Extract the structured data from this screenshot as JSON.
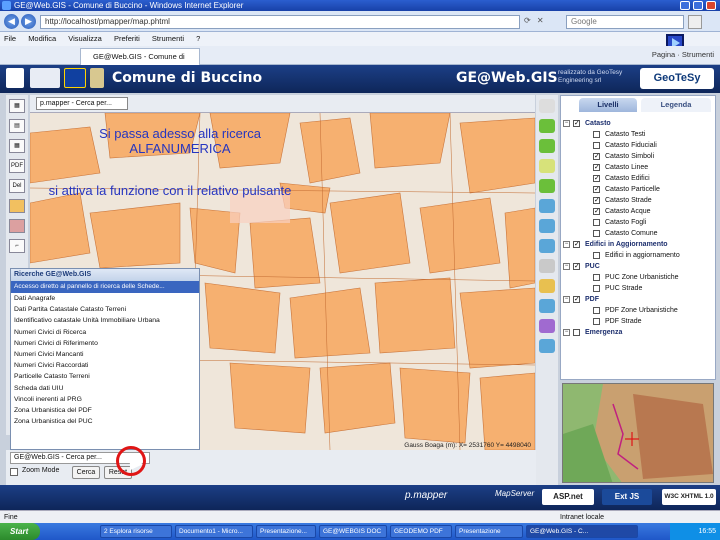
{
  "browser": {
    "title": "GE@Web.GIS - Comune di Buccino - Windows Internet Explorer",
    "url": "http://localhost/pmapper/map.phtml",
    "search_placeholder": "Google",
    "menu": [
      "File",
      "Modifica",
      "Visualizza",
      "Preferiti",
      "Strumenti",
      "?"
    ],
    "tab_label": "GE@Web.GIS - Comune di Buccino",
    "tools": [
      "Pagina",
      "Strumenti"
    ]
  },
  "app": {
    "title": "Comune di Buccino",
    "brand": "GE@Web.GIS",
    "subtitle": "realizzato da GeoTesy Engineering srl",
    "partner": "GeoTeSy",
    "map_select": "p.mapper - Cerca per..."
  },
  "overlay": {
    "note1": "Si passa adesso alla ricerca ALFANUMERICA",
    "note2": "si attiva la funzione con il relativo pulsante"
  },
  "search_panel": {
    "title": "Ricerche GE@Web.GIS",
    "selected": "Accesso diretto al pannello di ricerca delle Schede...",
    "items": [
      "Dati Anagrafe",
      "Dati Partita Catastale Catasto Terreni",
      "Identificativo catastale Unità Immobiliare Urbana",
      "Numeri Civici di Ricerca",
      "Numeri Civici di Riferimento",
      "Numeri Civici Mancanti",
      "Numeri Civici Raccordati",
      "Particelle Catasto Terreni",
      "Scheda dati UIU",
      "Vincoli inerenti al PRG",
      "Zona Urbanistica del PDF",
      "Zona Urbanistica del PUC"
    ]
  },
  "bottom_search": {
    "field": "GE@Web.GIS - Cerca per...",
    "zoom_mode": "Zoom Mode",
    "search_btn": "Cerca",
    "reset_btn": "Reset"
  },
  "map": {
    "scale_text": "Gauss Boaga (m): X= 2531760 Y= 4498040"
  },
  "layers": {
    "tab_livelli": "Livelli",
    "tab_legenda": "Legenda",
    "rows": [
      {
        "label": "Catasto",
        "type": "group",
        "checked": true
      },
      {
        "label": "Catasto Testi",
        "type": "item",
        "checked": false
      },
      {
        "label": "Catasto Fiduciali",
        "type": "item",
        "checked": false
      },
      {
        "label": "Catasto Simboli",
        "type": "item",
        "checked": true
      },
      {
        "label": "Catasto Linee",
        "type": "item",
        "checked": true
      },
      {
        "label": "Catasto Edifici",
        "type": "item",
        "checked": true
      },
      {
        "label": "Catasto Particelle",
        "type": "item",
        "checked": true
      },
      {
        "label": "Catasto Strade",
        "type": "item",
        "checked": true
      },
      {
        "label": "Catasto Acque",
        "type": "item",
        "checked": true
      },
      {
        "label": "Catasto Fogli",
        "type": "item",
        "checked": false
      },
      {
        "label": "Catasto Comune",
        "type": "item",
        "checked": false
      },
      {
        "label": "Edifici in Aggiornamento",
        "type": "group",
        "checked": true
      },
      {
        "label": "Edifici in aggiornamento",
        "type": "item",
        "checked": false
      },
      {
        "label": "PUC",
        "type": "group",
        "checked": true
      },
      {
        "label": "PUC Zone Urbanistiche",
        "type": "item",
        "checked": false
      },
      {
        "label": "PUC Strade",
        "type": "item",
        "checked": false
      },
      {
        "label": "PDF",
        "type": "group",
        "checked": true
      },
      {
        "label": "PDF Zone Urbanistiche",
        "type": "item",
        "checked": false
      },
      {
        "label": "PDF Strade",
        "type": "item",
        "checked": false
      },
      {
        "label": "Emergenza",
        "type": "group",
        "checked": false
      }
    ]
  },
  "footer": {
    "pmapper": "p.mapper",
    "mapserver": "MapServer",
    "aspnet": "ASP.net",
    "extjs": "Ext JS",
    "w3c": "W3C XHTML 1.0"
  },
  "status": {
    "left": "Fine",
    "right": "Intranet locale"
  },
  "taskbar": {
    "start": "Start",
    "tasks": [
      "2 Esplora risorse",
      "Documento1 - Micro...",
      "Presentazione...",
      "GE@WEBGIS DOC",
      "GEODEMO PDF",
      "Presentazione",
      "GE@Web.GIS - C..."
    ],
    "clock": "16:55"
  },
  "colors": {
    "header": "#1c3f86",
    "building": "#f4a868",
    "highlight": "#e01515",
    "note": "#2535c0"
  }
}
